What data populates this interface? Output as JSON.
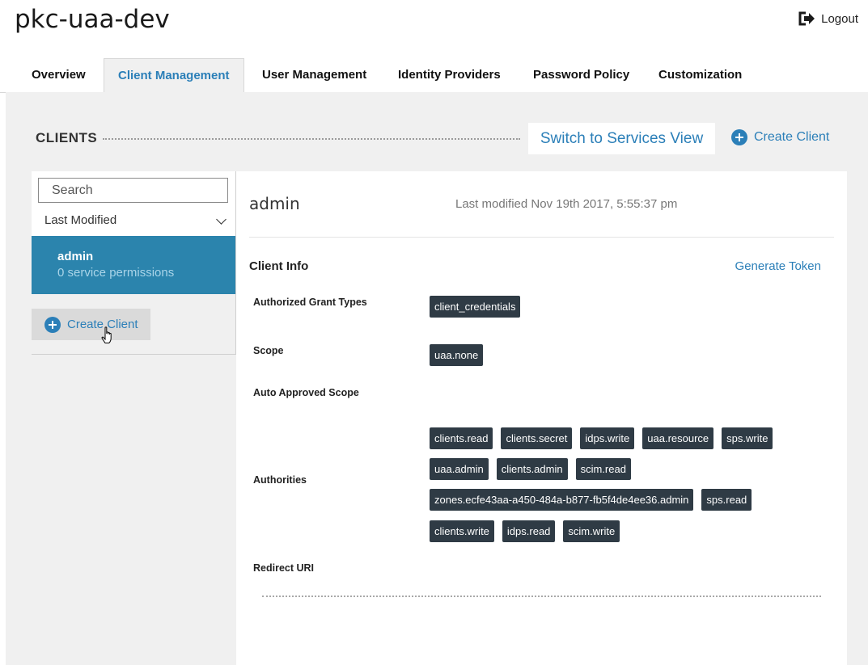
{
  "app_title": "pkc-uaa-dev",
  "logout_label": "Logout",
  "tabs": [
    {
      "label": "Overview"
    },
    {
      "label": "Client Management"
    },
    {
      "label": "User Management"
    },
    {
      "label": "Identity Providers"
    },
    {
      "label": "Password Policy"
    },
    {
      "label": "Customization"
    }
  ],
  "active_tab": "Client Management",
  "clients_header": {
    "title": "CLIENTS",
    "switch_view_label": "Switch to Services View",
    "create_client_label": "Create Client"
  },
  "sidebar": {
    "search_placeholder": "Search",
    "sort_label": "Last Modified",
    "clients": [
      {
        "name": "admin",
        "subtitle": "0 service permissions"
      }
    ],
    "create_client_label": "Create Client"
  },
  "detail": {
    "client_name": "admin",
    "last_modified": "Last modified Nov 19th 2017, 5:55:37 pm",
    "section_title": "Client Info",
    "generate_token_label": "Generate Token",
    "labels": {
      "grant_types": "Authorized Grant Types",
      "scope": "Scope",
      "auto_approved_scope": "Auto Approved Scope",
      "authorities": "Authorities",
      "redirect_uri": "Redirect URI"
    },
    "grant_types": [
      "client_credentials"
    ],
    "scope": [
      "uaa.none"
    ],
    "auto_approved_scope": [],
    "authorities_rows": [
      [
        "clients.read",
        "clients.secret",
        "idps.write",
        "uaa.resource",
        "sps.write"
      ],
      [
        "uaa.admin",
        "clients.admin",
        "scim.read"
      ],
      [
        "zones.ecfe43aa-a450-484a-b877-fb5f4de4ee36.admin",
        "sps.read"
      ],
      [
        "clients.write",
        "idps.read",
        "scim.write"
      ]
    ]
  },
  "colors": {
    "accent": "#2b7fb8",
    "selected_item": "#2b84ad",
    "tag_bg": "#2f3b45",
    "page_bg": "#f0f0f0"
  }
}
